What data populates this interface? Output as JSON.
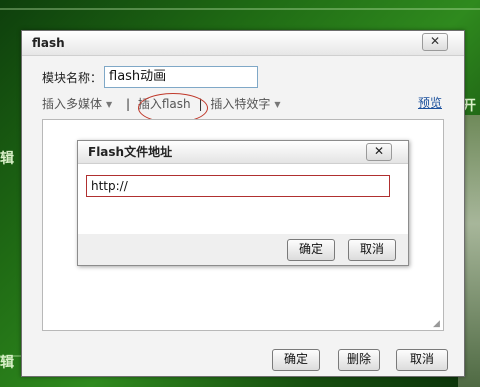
{
  "background": {
    "left_text_1": "辑",
    "left_text_2": "辑",
    "right_text_1": "开 基",
    "right_text_2": "编 "
  },
  "dialog": {
    "title": "flash",
    "close_label": "✕",
    "module_name_label": "模块名称：",
    "module_name_value": "flash动画",
    "toolbar": {
      "insert_media": "插入多媒体",
      "insert_flash": "插入flash",
      "insert_effects": "插入特效字",
      "preview": "预览"
    },
    "buttons": {
      "ok": "确定",
      "delete": "删除",
      "cancel": "取消"
    }
  },
  "subdialog": {
    "title": "Flash文件地址",
    "close_label": "✕",
    "url_value": "http://",
    "buttons": {
      "ok": "确定",
      "cancel": "取消"
    }
  },
  "colors": {
    "highlight": "#c0392b",
    "link": "#1a4f9c",
    "background": "#1f6a14"
  }
}
